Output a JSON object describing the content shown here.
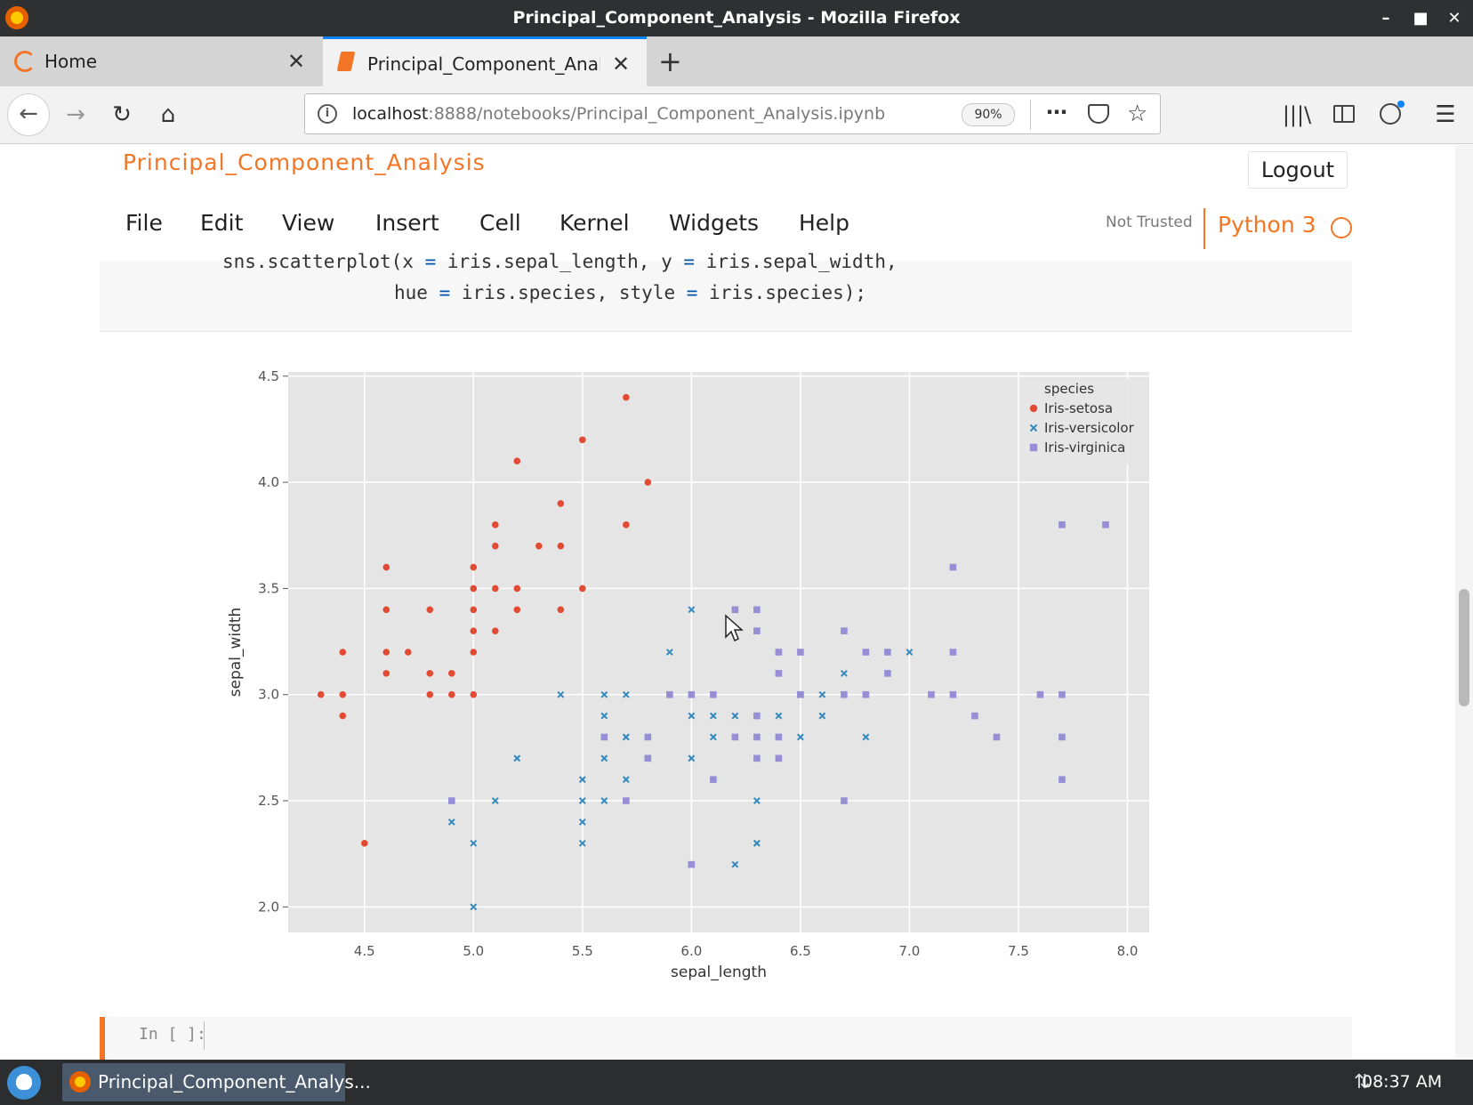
{
  "window": {
    "title": "Principal_Component_Analysis - Mozilla Firefox"
  },
  "tabs": [
    {
      "label": "Home"
    },
    {
      "label": "Principal_Component_Analysis"
    }
  ],
  "navbar": {
    "url_host": "localhost",
    "url_rest": ":8888/notebooks/Principal_Component_Analysis.ipynb",
    "zoom": "90%"
  },
  "jupyter": {
    "notebook_title": "Principal_Component_Analysis",
    "logout": "Logout",
    "menu": [
      "File",
      "Edit",
      "View",
      "Insert",
      "Cell",
      "Kernel",
      "Widgets",
      "Help"
    ],
    "trust": "Not Trusted",
    "kernel": "Python 3"
  },
  "cells": {
    "code_line1_parts": [
      "sns.scatterplot(x ",
      "=",
      " iris.sepal_length, y ",
      "=",
      " iris.sepal_width,"
    ],
    "code_line2_parts": [
      "hue ",
      "=",
      " iris.species, style ",
      "=",
      " iris.species);"
    ],
    "empty_prompt": "In [ ]:"
  },
  "taskbar": {
    "app_label": "Principal_Component_Analys...",
    "clock": "08:37 AM"
  },
  "chart_data": {
    "type": "scatter",
    "xlabel": "sepal_length",
    "ylabel": "sepal_width",
    "xlim": [
      4.15,
      8.1
    ],
    "ylim": [
      1.88,
      4.52
    ],
    "xticks": [
      4.5,
      5.0,
      5.5,
      6.0,
      6.5,
      7.0,
      7.5,
      8.0
    ],
    "xtick_labels": [
      "4.5",
      "5.0",
      "5.5",
      "6.0",
      "6.5",
      "7.0",
      "7.5",
      "8.0"
    ],
    "yticks": [
      2.0,
      2.5,
      3.0,
      3.5,
      4.0,
      4.5
    ],
    "ytick_labels": [
      "2.0",
      "2.5",
      "3.0",
      "3.5",
      "4.0",
      "4.5"
    ],
    "grid": true,
    "legend": {
      "title": "species",
      "placement": "top-right"
    },
    "series": [
      {
        "name": "Iris-setosa",
        "color": "#e24a33",
        "marker": "circle",
        "points": [
          [
            5.1,
            3.5
          ],
          [
            4.9,
            3.0
          ],
          [
            4.7,
            3.2
          ],
          [
            4.6,
            3.1
          ],
          [
            5.0,
            3.6
          ],
          [
            5.4,
            3.9
          ],
          [
            4.6,
            3.4
          ],
          [
            5.0,
            3.4
          ],
          [
            4.4,
            2.9
          ],
          [
            4.9,
            3.1
          ],
          [
            5.4,
            3.7
          ],
          [
            4.8,
            3.4
          ],
          [
            4.8,
            3.0
          ],
          [
            4.3,
            3.0
          ],
          [
            5.8,
            4.0
          ],
          [
            5.7,
            4.4
          ],
          [
            5.7,
            3.8
          ],
          [
            5.1,
            3.8
          ],
          [
            5.1,
            3.7
          ],
          [
            4.6,
            3.6
          ],
          [
            5.1,
            3.3
          ],
          [
            5.0,
            3.0
          ],
          [
            5.2,
            3.5
          ],
          [
            5.2,
            3.4
          ],
          [
            4.8,
            3.1
          ],
          [
            5.5,
            4.2
          ],
          [
            5.2,
            4.1
          ],
          [
            5.5,
            3.5
          ],
          [
            4.4,
            3.0
          ],
          [
            4.5,
            2.3
          ],
          [
            4.4,
            3.2
          ],
          [
            5.0,
            3.5
          ],
          [
            5.3,
            3.7
          ],
          [
            5.0,
            3.3
          ],
          [
            5.4,
            3.4
          ],
          [
            5.0,
            3.2
          ],
          [
            4.6,
            3.2
          ]
        ]
      },
      {
        "name": "Iris-versicolor",
        "color": "#348abd",
        "marker": "x",
        "points": [
          [
            7.0,
            3.2
          ],
          [
            6.5,
            2.8
          ],
          [
            5.5,
            2.3
          ],
          [
            5.7,
            2.8
          ],
          [
            6.3,
            3.3
          ],
          [
            4.9,
            2.4
          ],
          [
            5.2,
            2.7
          ],
          [
            5.0,
            2.0
          ],
          [
            5.9,
            3.0
          ],
          [
            6.0,
            2.2
          ],
          [
            6.1,
            2.9
          ],
          [
            5.6,
            2.9
          ],
          [
            6.7,
            3.1
          ],
          [
            5.6,
            3.0
          ],
          [
            5.8,
            2.7
          ],
          [
            6.2,
            2.2
          ],
          [
            5.6,
            2.5
          ],
          [
            5.9,
            3.2
          ],
          [
            6.3,
            2.5
          ],
          [
            6.1,
            2.8
          ],
          [
            6.4,
            2.9
          ],
          [
            6.6,
            3.0
          ],
          [
            6.8,
            2.8
          ],
          [
            6.0,
            2.9
          ],
          [
            5.7,
            2.6
          ],
          [
            5.5,
            2.4
          ],
          [
            5.8,
            2.7
          ],
          [
            6.0,
            2.7
          ],
          [
            5.4,
            3.0
          ],
          [
            6.0,
            3.4
          ],
          [
            6.3,
            2.3
          ],
          [
            5.5,
            2.5
          ],
          [
            5.5,
            2.6
          ],
          [
            5.0,
            2.3
          ],
          [
            5.6,
            2.7
          ],
          [
            5.7,
            3.0
          ],
          [
            6.2,
            2.9
          ],
          [
            5.1,
            2.5
          ],
          [
            5.7,
            2.8
          ],
          [
            6.6,
            2.9
          ],
          [
            6.3,
            2.3
          ]
        ]
      },
      {
        "name": "Iris-virginica",
        "color": "#988ed5",
        "marker": "square",
        "points": [
          [
            6.3,
            3.3
          ],
          [
            5.8,
            2.7
          ],
          [
            7.1,
            3.0
          ],
          [
            6.3,
            2.9
          ],
          [
            6.5,
            3.0
          ],
          [
            7.6,
            3.0
          ],
          [
            4.9,
            2.5
          ],
          [
            7.3,
            2.9
          ],
          [
            6.7,
            2.5
          ],
          [
            7.2,
            3.6
          ],
          [
            6.5,
            3.2
          ],
          [
            6.4,
            2.7
          ],
          [
            6.8,
            3.0
          ],
          [
            5.7,
            2.5
          ],
          [
            5.8,
            2.8
          ],
          [
            6.4,
            3.2
          ],
          [
            7.7,
            3.8
          ],
          [
            7.7,
            2.6
          ],
          [
            6.0,
            2.2
          ],
          [
            6.9,
            3.2
          ],
          [
            5.6,
            2.8
          ],
          [
            7.7,
            2.8
          ],
          [
            6.7,
            3.3
          ],
          [
            7.2,
            3.2
          ],
          [
            6.2,
            2.8
          ],
          [
            6.1,
            3.0
          ],
          [
            6.4,
            2.8
          ],
          [
            7.2,
            3.0
          ],
          [
            7.4,
            2.8
          ],
          [
            7.9,
            3.8
          ],
          [
            6.3,
            2.8
          ],
          [
            6.1,
            2.6
          ],
          [
            7.7,
            3.0
          ],
          [
            6.3,
            3.4
          ],
          [
            6.4,
            3.1
          ],
          [
            6.0,
            3.0
          ],
          [
            6.9,
            3.1
          ],
          [
            6.7,
            3.0
          ],
          [
            6.2,
            3.4
          ],
          [
            5.9,
            3.0
          ],
          [
            6.5,
            3.0
          ],
          [
            6.8,
            3.2
          ],
          [
            6.3,
            2.7
          ]
        ]
      }
    ]
  }
}
